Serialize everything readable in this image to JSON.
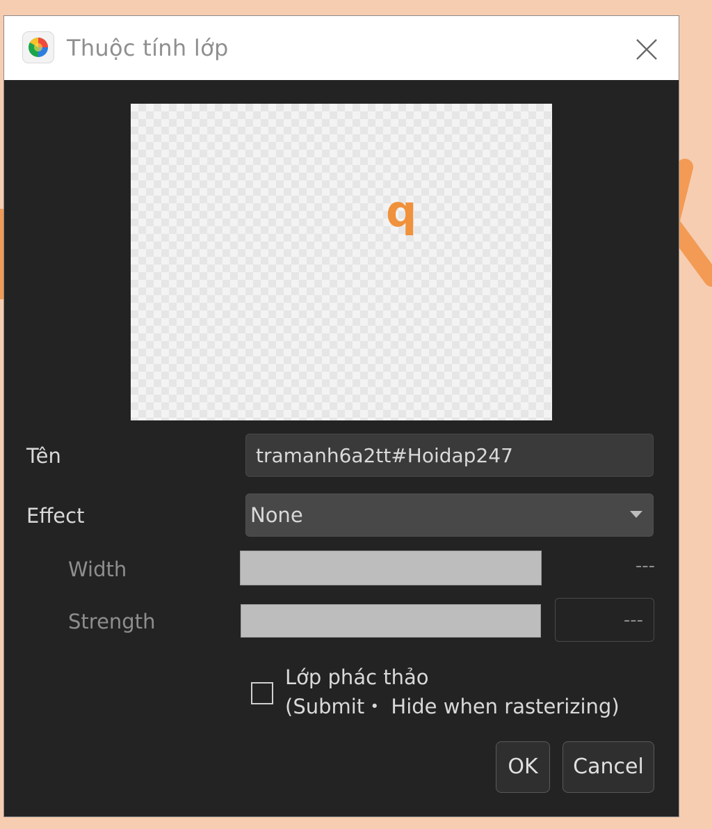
{
  "window": {
    "title": "Thuộc tính lớp",
    "app_icon": "medibang-icon",
    "close_icon": "close-icon"
  },
  "preview": {
    "glyph": "q"
  },
  "form": {
    "name_label": "Tên",
    "name_value": "tramanh6a2tt#Hoidap247",
    "effect_label": "Effect",
    "effect_value": "None",
    "width_label": "Width",
    "width_value": "---",
    "strength_label": "Strength",
    "strength_value": "---",
    "sketch_label_line1": "Lớp phác thảo",
    "sketch_label_line2": "(Submit・ Hide when rasterizing)",
    "sketch_checked": false
  },
  "buttons": {
    "ok": "OK",
    "cancel": "Cancel"
  },
  "colors": {
    "background": "#f6cdb0",
    "dialog_bg": "#232323",
    "accent_orange": "#f0913c"
  }
}
